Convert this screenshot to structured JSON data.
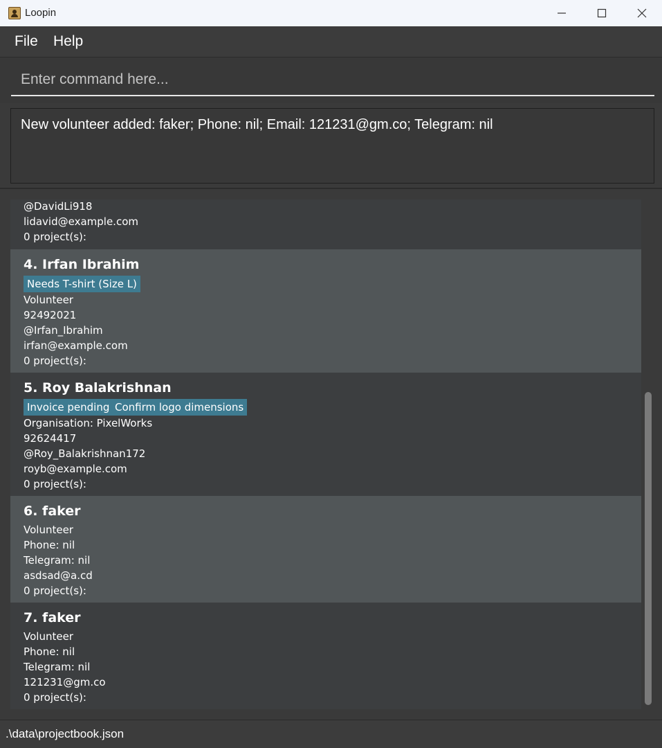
{
  "window": {
    "title": "Loopin"
  },
  "menu": {
    "file": "File",
    "help": "Help"
  },
  "command": {
    "placeholder": "Enter command here..."
  },
  "result": {
    "text": "New volunteer added: faker; Phone: nil; Email: 121231@gm.co; Telegram: nil"
  },
  "persons": [
    {
      "name": "",
      "tags": [],
      "lines": [
        "@DavidLi918",
        "lidavid@example.com",
        "0 project(s):"
      ]
    },
    {
      "name": "4. Irfan Ibrahim",
      "tags": [
        "Needs T-shirt (Size L)"
      ],
      "lines": [
        "Volunteer",
        "92492021",
        "@Irfan_Ibrahim",
        "irfan@example.com",
        "0 project(s):"
      ]
    },
    {
      "name": "5. Roy Balakrishnan",
      "tags": [
        "Invoice pending",
        "Confirm logo dimensions"
      ],
      "lines": [
        "Organisation: PixelWorks",
        "92624417",
        "@Roy_Balakrishnan172",
        "royb@example.com",
        "0 project(s):"
      ]
    },
    {
      "name": "6. faker",
      "tags": [],
      "lines": [
        "Volunteer",
        "Phone: nil",
        "Telegram: nil",
        "asdsad@a.cd",
        "0 project(s):"
      ]
    },
    {
      "name": "7. faker",
      "tags": [],
      "lines": [
        "Volunteer",
        "Phone: nil",
        "Telegram: nil",
        "121231@gm.co",
        "0 project(s):"
      ]
    }
  ],
  "status": {
    "path": ".\\data\\projectbook.json"
  },
  "colors": {
    "tag": "#3e7b91",
    "card_alt": "#515658",
    "card": "#3c3e40"
  }
}
